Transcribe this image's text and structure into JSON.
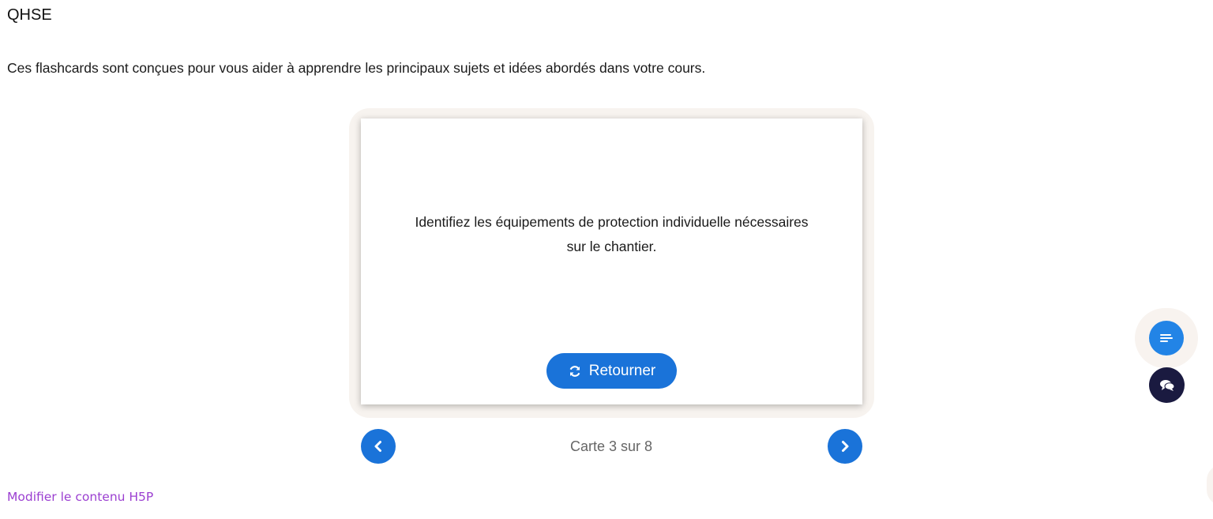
{
  "page": {
    "title": "QHSE",
    "description": "Ces flashcards sont conçues pour vous aider à apprendre les principaux sujets et idées abordés dans votre cours."
  },
  "flashcard": {
    "text": "Identifiez les équipements de protection individuelle nécessaires sur le chantier.",
    "flip_label": "Retourner",
    "flip_icon": "refresh-icon"
  },
  "navigation": {
    "counter": "Carte 3 sur 8",
    "current": 3,
    "total": 8,
    "prev_icon": "chevron-left-icon",
    "next_icon": "chevron-right-icon"
  },
  "footer": {
    "edit_link": "Modifier le contenu H5P"
  },
  "widgets": {
    "menu_icon": "text-lines-icon",
    "chat_icon": "chat-bubbles-icon"
  },
  "colors": {
    "accent": "#1a73d9",
    "link": "#9b3fd1",
    "chat_widget": "#1a1a40"
  }
}
